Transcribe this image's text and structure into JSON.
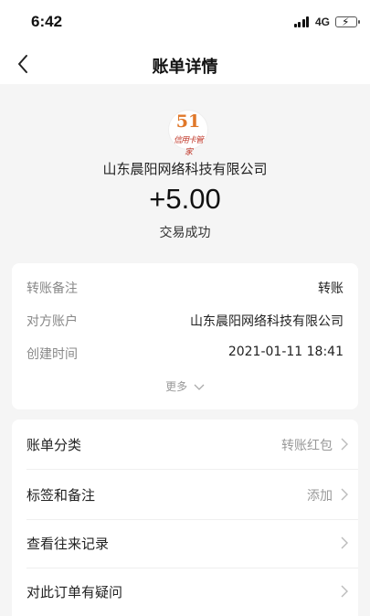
{
  "status_bar": {
    "time": "6:42",
    "network": "4G"
  },
  "nav": {
    "title": "账单详情"
  },
  "merchant": {
    "logo_number": "51",
    "logo_text": "信用卡管家",
    "name": "山东晨阳网络科技有限公司"
  },
  "transaction": {
    "amount": "+5.00",
    "status": "交易成功"
  },
  "details": [
    {
      "label": "转账备注",
      "value": "转账"
    },
    {
      "label": "对方账户",
      "value": "山东晨阳网络科技有限公司"
    },
    {
      "label": "创建时间",
      "value": "2021-01-11 18:41"
    }
  ],
  "more_label": "更多",
  "menu": [
    {
      "label": "账单分类",
      "value": "转账红包"
    },
    {
      "label": "标签和备注",
      "value": "添加"
    },
    {
      "label": "查看往来记录",
      "value": ""
    },
    {
      "label": "对此订单有疑问",
      "value": ""
    }
  ]
}
